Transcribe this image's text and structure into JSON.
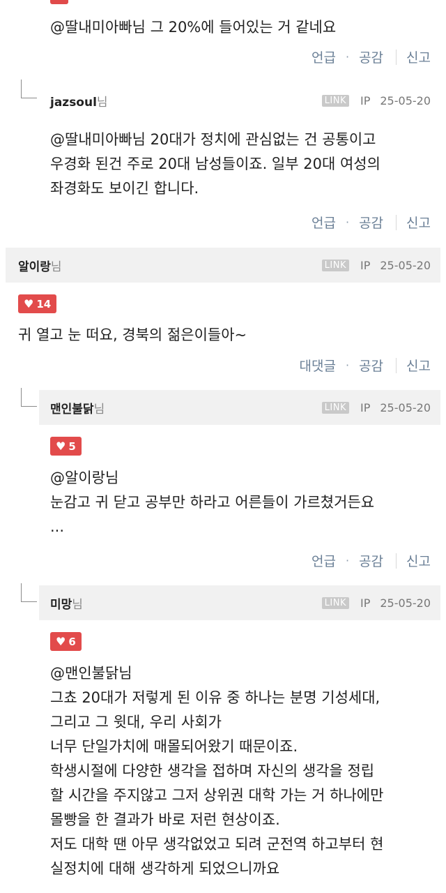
{
  "c1": {
    "text": "@딸내미아빠님 그 20%에 들어있는 거 같네요",
    "actions": [
      "언급",
      "공감",
      "신고"
    ]
  },
  "c2": {
    "name": "jazsoul",
    "suffix": "님",
    "link": "LINK",
    "ip": "IP",
    "date": "25-05-20",
    "lines": [
      "@딸내미아빠님 20대가 정치에 관심없는 건 공통이고",
      "우경화 된건 주로 20대 남성들이죠. 일부 20대 여성의",
      "좌경화도 보이긴 합니다."
    ],
    "actions": [
      "언급",
      "공감",
      "신고"
    ]
  },
  "c3": {
    "name": "알이랑",
    "suffix": "님",
    "link": "LINK",
    "ip": "IP",
    "date": "25-05-20",
    "likes": "14",
    "text": "귀 열고 눈 떠요, 경북의 젊은이들아~",
    "actions": [
      "대댓글",
      "공감",
      "신고"
    ]
  },
  "c4": {
    "name": "맨인불닭",
    "suffix": "님",
    "link": "LINK",
    "ip": "IP",
    "date": "25-05-20",
    "likes": "5",
    "lines": [
      "@알이랑님",
      "눈감고 귀 닫고 공부만 하라고 어른들이 가르쳤거든요",
      "..."
    ],
    "actions": [
      "언급",
      "공감",
      "신고"
    ]
  },
  "c5": {
    "name": "미망",
    "suffix": "님",
    "link": "LINK",
    "ip": "IP",
    "date": "25-05-20",
    "likes": "6",
    "lines": [
      "@맨인불닭님",
      "그쵸 20대가 저렇게 된 이유 중 하나는 분명 기성세대,",
      "그리고 그 윗대, 우리 사회가",
      "너무 단일가치에 매몰되어왔기 때문이죠.",
      "학생시절에 다양한 생각을 접하며 자신의 생각을 정립",
      "할 시간을 주지않고 그저 상위권 대학 가는 거 하나에만",
      "몰빵을 한 결과가 바로 저런 현상이죠.",
      "저도 대학 땐 아무 생각없었고 되려 군전역 하고부터 현",
      "실정치에 대해 생각하게 되었으니까요"
    ]
  },
  "colors": {
    "like_red": "#e24b4b",
    "action_blue": "#6a7f96",
    "header_bg": "#f1f1f1",
    "link_badge": "#c9c9c9"
  }
}
